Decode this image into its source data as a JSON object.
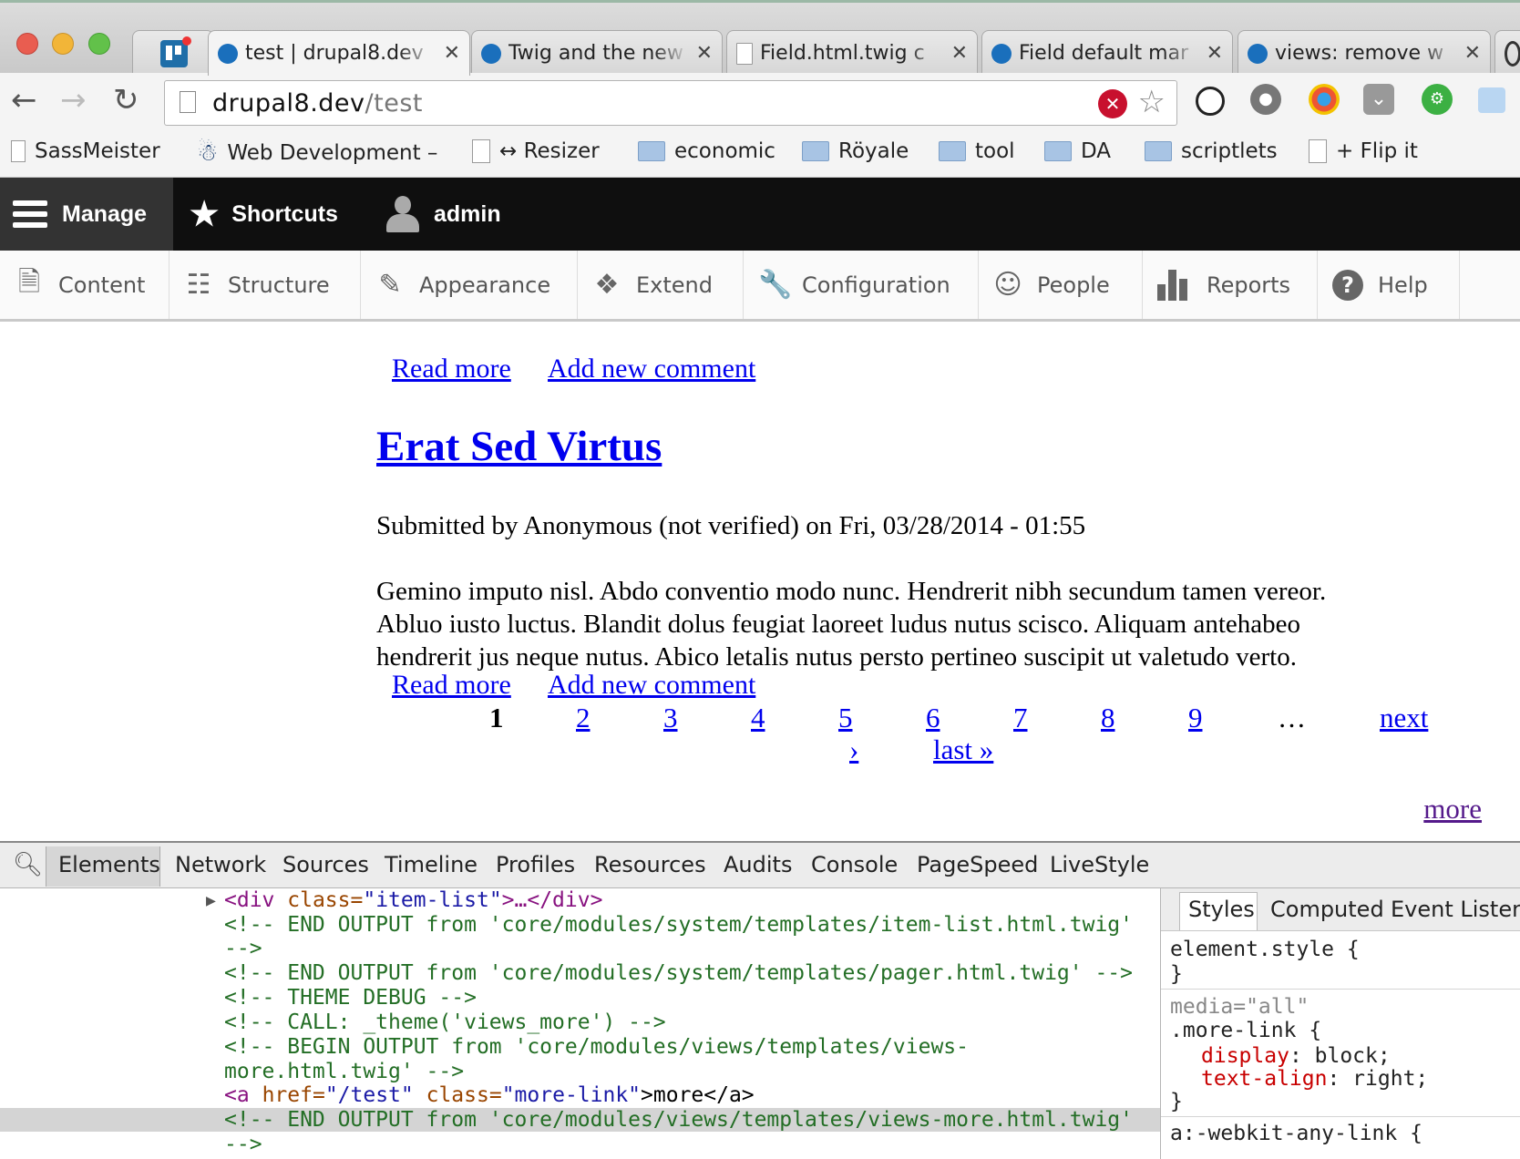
{
  "browser": {
    "tabs": [
      {
        "title": "",
        "icon": "trello-icon"
      },
      {
        "title": "test | drupal8.dev",
        "icon": "drupal-icon",
        "active": true
      },
      {
        "title": "Twig and the new",
        "icon": "drupal-icon"
      },
      {
        "title": "Field.html.twig c",
        "icon": "document-icon"
      },
      {
        "title": "Field default mar",
        "icon": "drupal-icon"
      },
      {
        "title": "views: remove w",
        "icon": "drupal-icon"
      }
    ],
    "tab_close_glyph": "✕",
    "url_host": "drupal8.dev",
    "url_path": "/test",
    "bookmarks": [
      {
        "label": "SassMeister",
        "icon": "none"
      },
      {
        "label": "Web Development –",
        "icon": "jenkins-icon"
      },
      {
        "label": "↔ Resizer",
        "icon": "page-icon"
      },
      {
        "label": "economic",
        "icon": "folder-icon"
      },
      {
        "label": "Röyale",
        "icon": "folder-icon"
      },
      {
        "label": "tool",
        "icon": "folder-icon"
      },
      {
        "label": "DA",
        "icon": "folder-icon"
      },
      {
        "label": "scriptlets",
        "icon": "folder-icon"
      },
      {
        "label": "+ Flip it",
        "icon": "page-icon"
      }
    ]
  },
  "drupal_toolbar": {
    "manage": "Manage",
    "shortcuts": "Shortcuts",
    "user": "admin",
    "tray": [
      "Content",
      "Structure",
      "Appearance",
      "Extend",
      "Configuration",
      "People",
      "Reports",
      "Help"
    ]
  },
  "content": {
    "top_links": {
      "read_more": "Read more",
      "add_comment": "Add new comment"
    },
    "node_title": "Erat Sed Virtus",
    "submitted": "Submitted by Anonymous (not verified) on Fri, 03/28/2014 - 01:55",
    "body_lines": [
      "Gemino imputo nisl. Abdo conventio modo nunc. Hendrerit nibh secundum tamen vereor.",
      "Abluo iusto luctus. Blandit dolus feugiat laoreet ludus nutus scisco. Aliquam antehabeo",
      "hendrerit jus neque nutus. Abico letalis nutus persto pertineo suscipit ut valetudo verto."
    ],
    "bottom_links": {
      "read_more": "Read more",
      "add_comment": "Add new comment"
    },
    "pager": {
      "current": "1",
      "pages": [
        "2",
        "3",
        "4",
        "5",
        "6",
        "7",
        "8",
        "9"
      ],
      "ellipsis": "…",
      "next": "next",
      "next_arrow": "›",
      "last": "last »"
    },
    "more": "more"
  },
  "devtools": {
    "tabs": [
      "Elements",
      "Network",
      "Sources",
      "Timeline",
      "Profiles",
      "Resources",
      "Audits",
      "Console",
      "PageSpeed",
      "LiveStyle"
    ],
    "dom_lines": [
      "<!-- END OUTPUT from 'core/modules/system/templates/item-list.html.twig'",
      "-->",
      "<!-- END OUTPUT from 'core/modules/system/templates/pager.html.twig' -->",
      "<!-- THEME DEBUG -->",
      "<!-- CALL: _theme('views_more') -->",
      "<!-- BEGIN OUTPUT from 'core/modules/views/templates/views-",
      "more.html.twig' -->",
      "<!-- END OUTPUT from 'core/modules/views/templates/views-more.html.twig'",
      "-->"
    ],
    "dom_first": {
      "open": "<div",
      "attr": "class=",
      "val": "\"item-list\"",
      "rest": ">…</div>"
    },
    "dom_selected": {
      "open": "<a",
      "a1": "href=",
      "v1": "\"/test\"",
      "a2": "class=",
      "v2": "\"more-link\"",
      "txt": ">more</a>"
    },
    "styles_tabs": [
      "Styles",
      "Computed",
      "Event Listen"
    ],
    "styles": {
      "element_style": "element.style {",
      "close": "}",
      "media": "media=\"all\"",
      "selector": ".more-link {",
      "rules": [
        {
          "prop": "display",
          "value": ": block;"
        },
        {
          "prop": "text-align",
          "value": ": right;"
        }
      ],
      "next_selector": "a:-webkit-any-link {"
    }
  }
}
